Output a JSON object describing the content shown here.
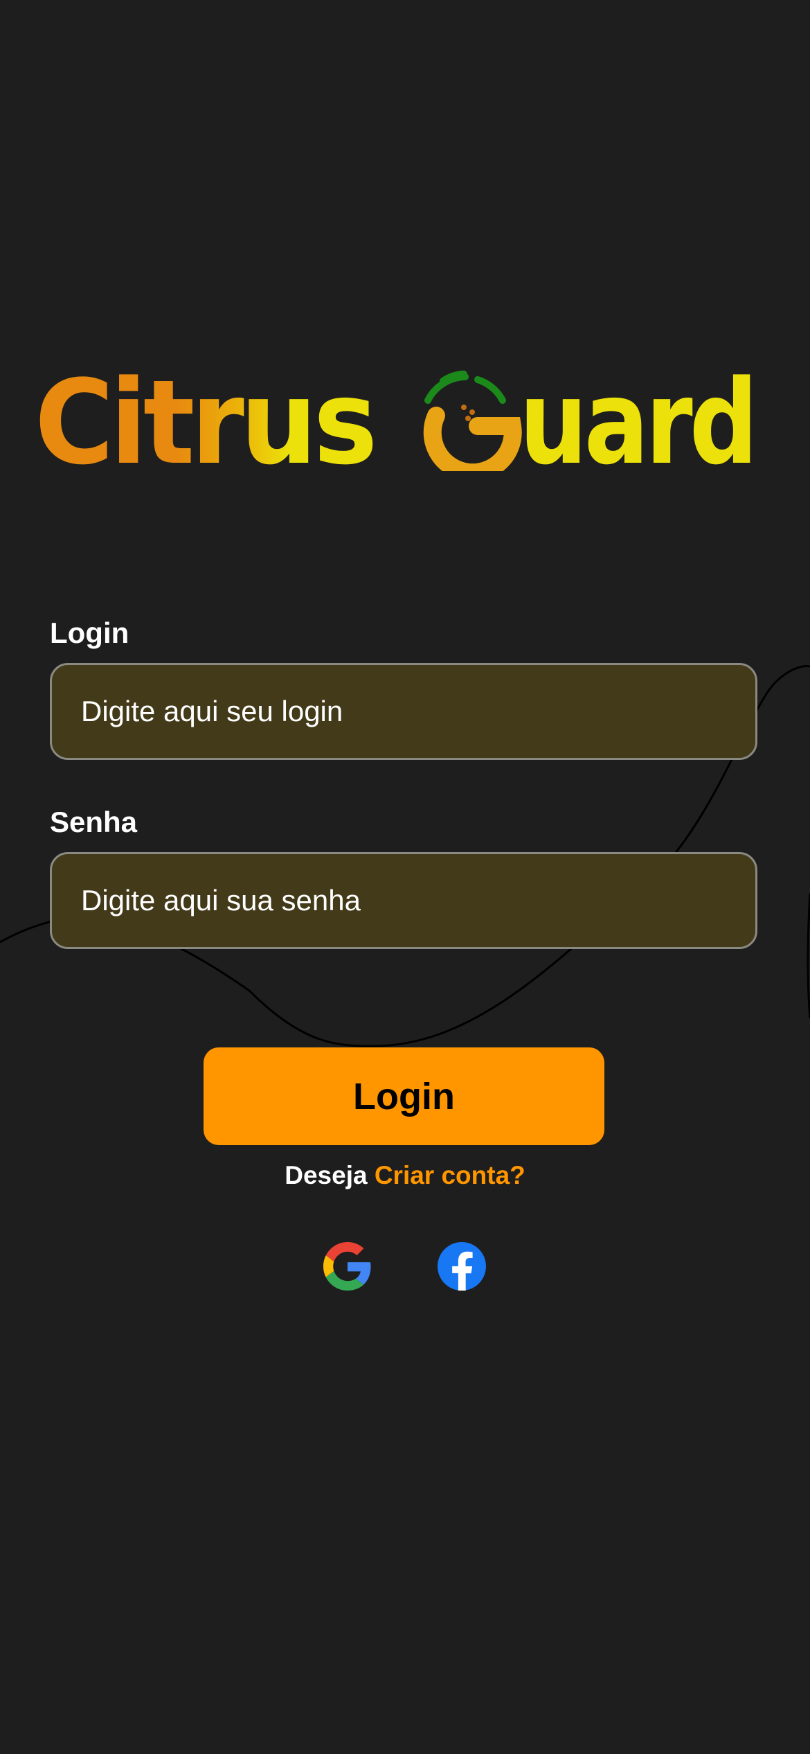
{
  "brand": {
    "name_part1": "Citrus",
    "name_part2": "uard",
    "colors": {
      "orange": "#e88a10",
      "yellow": "#ece10a",
      "green": "#1b8a1b"
    }
  },
  "form": {
    "login_label": "Login",
    "login_placeholder": "Digite aqui seu login",
    "password_label": "Senha",
    "password_placeholder": "Digite aqui sua senha",
    "submit_label": "Login"
  },
  "signup": {
    "prefix": "Deseja",
    "link": "Criar conta?"
  },
  "social": {
    "google_icon": "google-icon",
    "facebook_icon": "facebook-icon"
  },
  "theme": {
    "background": "#1e1e1e",
    "accent": "#ff9600",
    "input_background": "#433a19"
  }
}
